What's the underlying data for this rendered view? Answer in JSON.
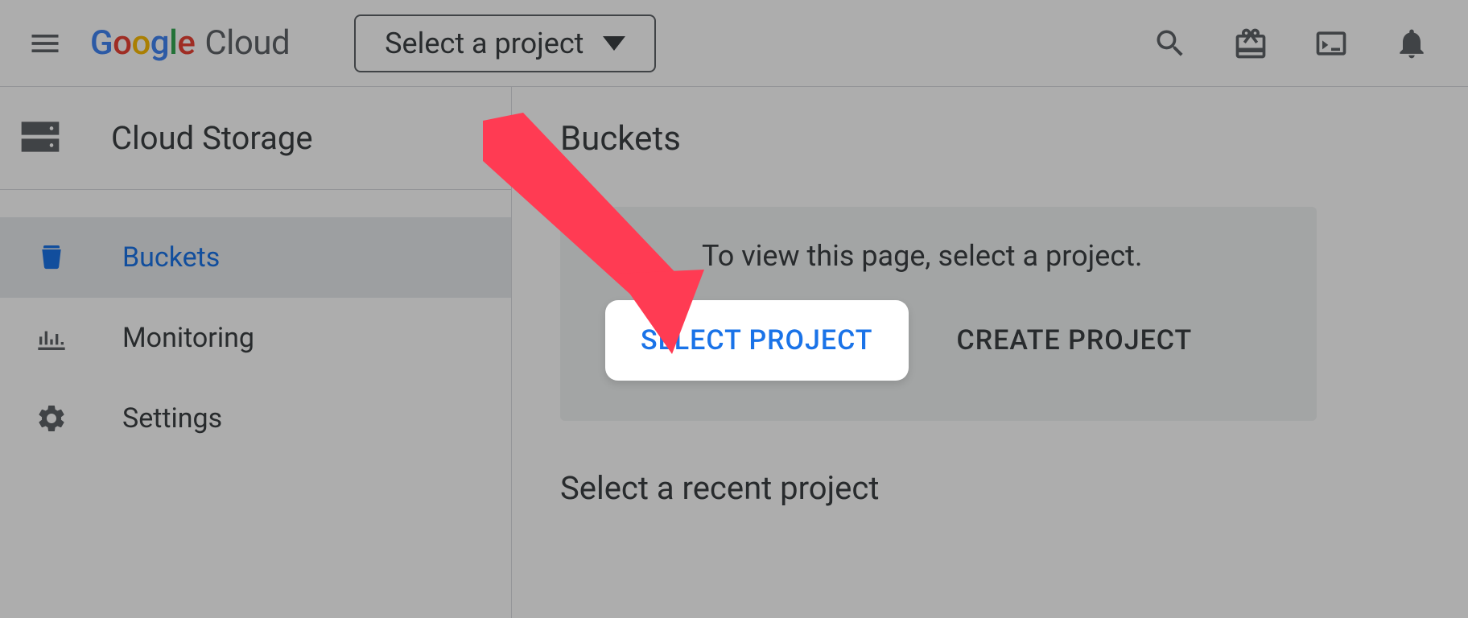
{
  "header": {
    "logo_brand": "Google",
    "logo_product": "Cloud",
    "project_picker_label": "Select a project"
  },
  "sidebar": {
    "title": "Cloud Storage",
    "items": [
      {
        "label": "Buckets",
        "icon": "bucket-icon",
        "selected": true
      },
      {
        "label": "Monitoring",
        "icon": "chart-icon",
        "selected": false
      },
      {
        "label": "Settings",
        "icon": "gear-icon",
        "selected": false
      }
    ]
  },
  "main": {
    "title": "Buckets",
    "prompt_text": "To view this page, select a project.",
    "select_project_label": "SELECT PROJECT",
    "create_project_label": "CREATE PROJECT",
    "recent_heading": "Select a recent project"
  },
  "annotation": {
    "arrow_color": "#ff3b53"
  }
}
